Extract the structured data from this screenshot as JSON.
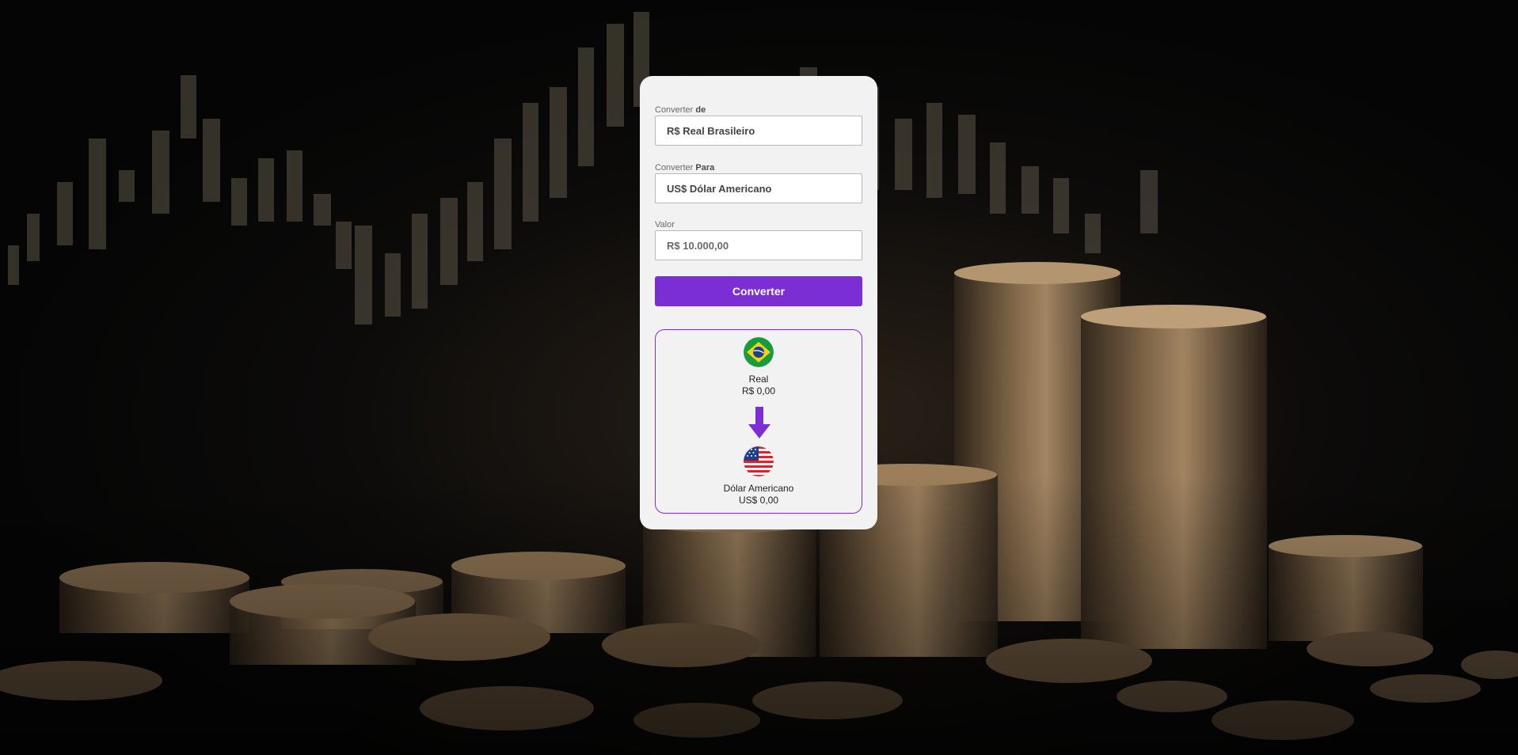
{
  "form": {
    "from_label_prefix": "Converter",
    "from_label_bold": "de",
    "from_selected": "R$ Real Brasileiro",
    "to_label_prefix": "Converter",
    "to_label_bold": "Para",
    "to_selected": "US$ Dólar Americano",
    "value_label": "Valor",
    "value_placeholder": "R$ 10.000,00",
    "convert_button_label": "Converter"
  },
  "result": {
    "from_currency_name": "Real",
    "from_currency_value": "R$ 0,00",
    "from_flag_icon": "brazil-flag-icon",
    "arrow_icon": "arrow-down-icon",
    "to_currency_name": "Dólar Americano",
    "to_currency_value": "US$ 0,00",
    "to_flag_icon": "usa-flag-icon"
  },
  "colors": {
    "accent": "#7a2ed3",
    "card_background": "#f2f2f2",
    "page_background": "#060607"
  }
}
